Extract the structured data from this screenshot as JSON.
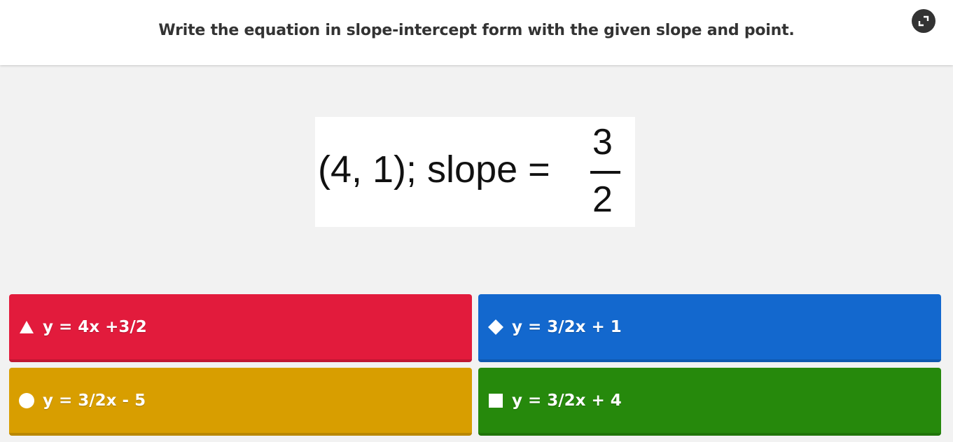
{
  "question": {
    "text": "Write the equation in slope-intercept form with the given slope and point."
  },
  "media": {
    "equation_prefix": "(4, 1); slope =",
    "fraction_numerator": "3",
    "fraction_denominator": "2"
  },
  "answers": [
    {
      "label": "y = 4x +3/2",
      "shape": "triangle-icon",
      "color": "#e21b3c"
    },
    {
      "label": "y = 3/2x + 1",
      "shape": "diamond-icon",
      "color": "#1368ce"
    },
    {
      "label": "y = 3/2x - 5",
      "shape": "circle-icon",
      "color": "#d89e00"
    },
    {
      "label": "y = 3/2x + 4",
      "shape": "square-icon",
      "color": "#26890c"
    }
  ],
  "icons": {
    "fullscreen": "fullscreen-icon"
  }
}
